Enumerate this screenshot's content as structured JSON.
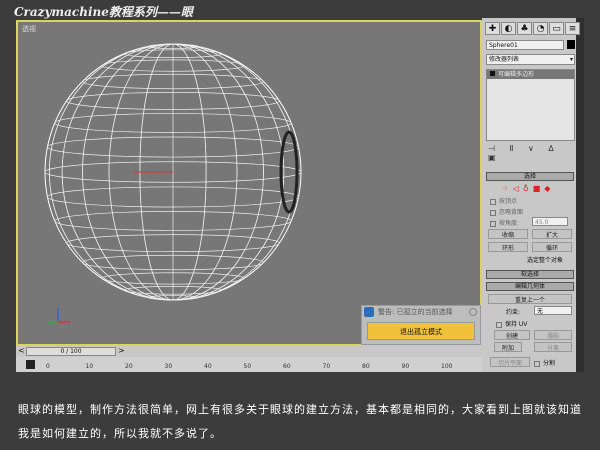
{
  "title": "Crazymachine教程系列——眼",
  "viewport": {
    "label": "透视"
  },
  "popup": {
    "header": "警告: 已孤立的当前选择",
    "button": "退出孤立模式"
  },
  "timeline": {
    "frame": "0 / 100",
    "prev": "<",
    "next": ">",
    "ticks": [
      "0",
      "10",
      "20",
      "30",
      "40",
      "50",
      "60",
      "70",
      "80",
      "90",
      "100"
    ]
  },
  "panel": {
    "object_name": "Sphere01",
    "modifier_list": "修改器列表",
    "stack_item": "可编辑多边形",
    "select_rollout": "选择",
    "by_vertex": "按顶点",
    "ignore_backface": "忽略背面",
    "by_angle": "按角度:",
    "angle_value": "45.0",
    "shrink": "收缩",
    "grow": "扩大",
    "ring": "环形",
    "loop": "循环",
    "select_whole": "选定整个对象",
    "soft_select": "软选择",
    "edit_geometry": "编辑几何体",
    "repeat_last": "重复上一个",
    "constraint_label": "约束:",
    "constraint_value": "无",
    "preserve_uv": "保持 UV",
    "create": "创建",
    "collapse": "塌陷",
    "attach": "附加",
    "detach": "分离",
    "slice_plane": "切片平面",
    "split": "分割"
  },
  "caption": "眼球的模型，制作方法很简单，网上有很多关于眼球的建立方法，基本都是相同的，大家看到上图就该知道我是如何建立的，所以我就不多说了。",
  "colors": {
    "viewport": "#777777",
    "border": "#d9d55a",
    "button": "#f0c23a"
  }
}
